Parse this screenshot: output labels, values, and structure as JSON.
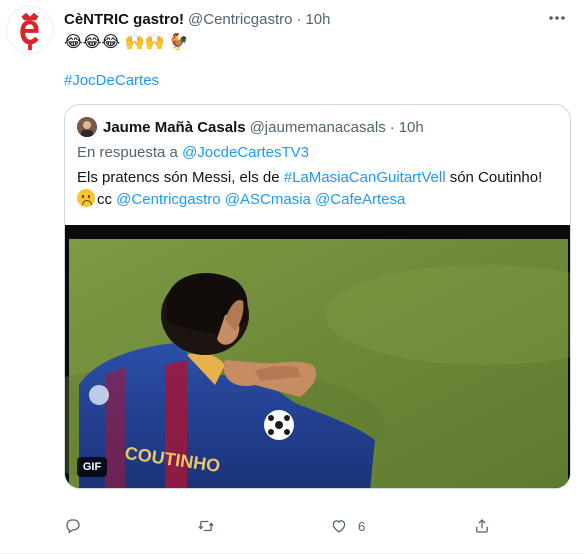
{
  "tweet": {
    "author_name": "CèNTRIC gastro!",
    "author_handle": "@Centricgastro",
    "separator": "·",
    "time": "10h",
    "emojis": "😂😂😂 🙌🙌 🐓",
    "hashtag": "#JocDeCartes"
  },
  "quoted": {
    "author_name": "Jaume Mañà Casals",
    "author_handle": "@jaumemanacasals",
    "separator": "·",
    "time": "10h",
    "reply_prefix": "En respuesta a",
    "reply_handle": "@JocdeCartesTV3",
    "text_1": "Els pratencs són Messi, els de",
    "text_hashtag": "#LaMasiaCanGuitartVell",
    "text_2": "són Coutinho!",
    "cc": "cc",
    "mention_1": "@Centricgastro",
    "mention_2": "@ASCmasia",
    "mention_3": "@CafeArtesa",
    "gif_label": "GIF",
    "jersey_text": "COUTINHO"
  },
  "actions": {
    "like_count": "6"
  },
  "icons": {
    "avatar": "centric-logo-icon",
    "more": "more-icon",
    "reply": "reply-icon",
    "retweet": "retweet-icon",
    "like": "heart-icon",
    "share": "share-icon",
    "sad_emoji": "frowning-face-icon"
  },
  "colors": {
    "link": "#1d9bf0",
    "secondary_text": "#536471",
    "brand_red": "#d6252b",
    "pitch_green": "#6f8a37"
  }
}
